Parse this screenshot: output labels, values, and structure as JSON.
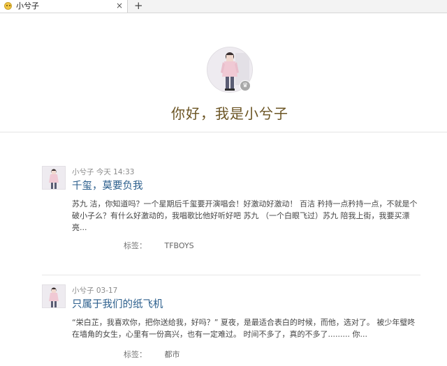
{
  "browser": {
    "tab_title": "小兮子",
    "tab_close": "×",
    "new_tab": "+"
  },
  "profile": {
    "greeting": "你好，我是小兮子"
  },
  "posts": [
    {
      "author": "小兮子",
      "time": "今天 14:33",
      "title": "千玺，莫要负我",
      "excerpt": "苏九 洁，你知道吗？一个星期后千玺要开演唱会！好激动好激动！ 百洁 矜持一点矜持一点，不就是个破小子么？有什么好激动的，我唱歌比他好听好吧 苏九 （一个白眼飞过）苏九 陪我上街，我要买漂亮...",
      "tag_label": "标签：",
      "tag": "TFBOYS"
    },
    {
      "author": "小兮子",
      "time": "03-17",
      "title": "只属于我们的纸飞机",
      "excerpt": "“栄白芷，我喜欢你，把你送给我，好吗？” 夏夜，是最适合表白的时候，而他，选对了。 被少年璧咚在墙角的女生，心里有一份高兴，也有一定难过。 时间不多了，真的不多了......... 你...",
      "tag_label": "标签：",
      "tag": "都市"
    }
  ],
  "colors": {
    "title": "#6b5423",
    "post_title": "#2b5e8c",
    "meta": "#8a8a8a"
  },
  "icons": [
    "smiley-favicon-icon",
    "close-icon",
    "plus-icon",
    "crown-badge-icon"
  ]
}
